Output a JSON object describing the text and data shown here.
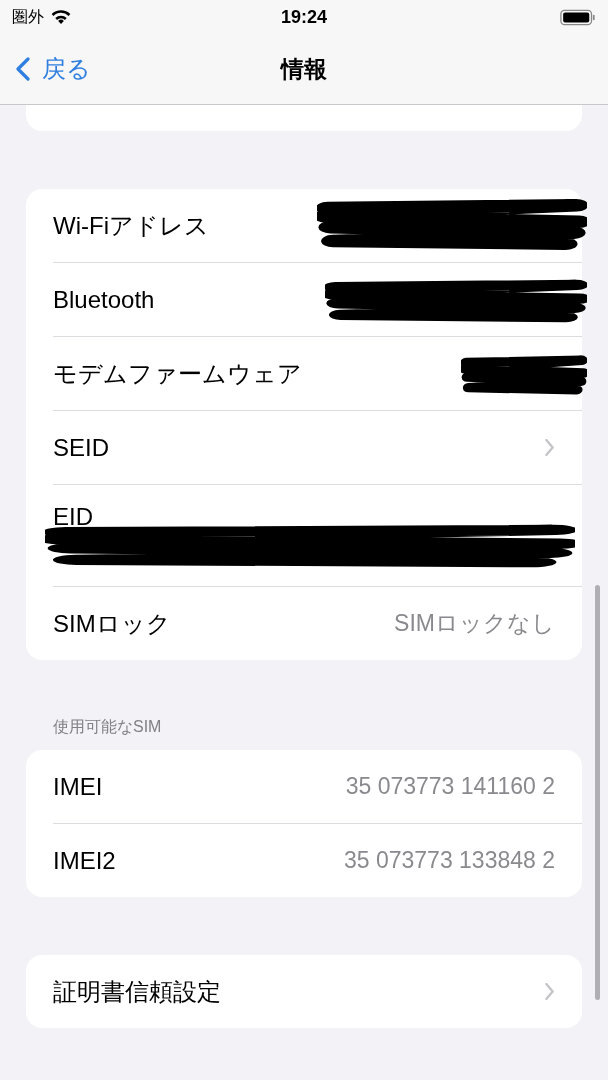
{
  "status_bar": {
    "carrier": "圏外",
    "time": "19:24"
  },
  "nav_bar": {
    "back": "戻る",
    "title": "情報"
  },
  "groups": [
    {
      "rows": [
        {
          "label": "Wi-Fiアドレス",
          "kind": "redacted"
        },
        {
          "label": "Bluetooth",
          "kind": "redacted"
        },
        {
          "label": "モデムファームウェア",
          "kind": "redacted"
        },
        {
          "label": "SEID",
          "kind": "link"
        },
        {
          "label": "EID",
          "kind": "redacted_below"
        },
        {
          "label": "SIMロック",
          "kind": "value",
          "value": "SIMロックなし"
        }
      ]
    },
    {
      "header": "使用可能なSIM",
      "rows": [
        {
          "label": "IMEI",
          "kind": "value",
          "value": "35 073773 141160 2"
        },
        {
          "label": "IMEI2",
          "kind": "value",
          "value": "35 073773 133848 2"
        }
      ]
    },
    {
      "rows": [
        {
          "label": "証明書信頼設定",
          "kind": "link"
        }
      ]
    }
  ]
}
